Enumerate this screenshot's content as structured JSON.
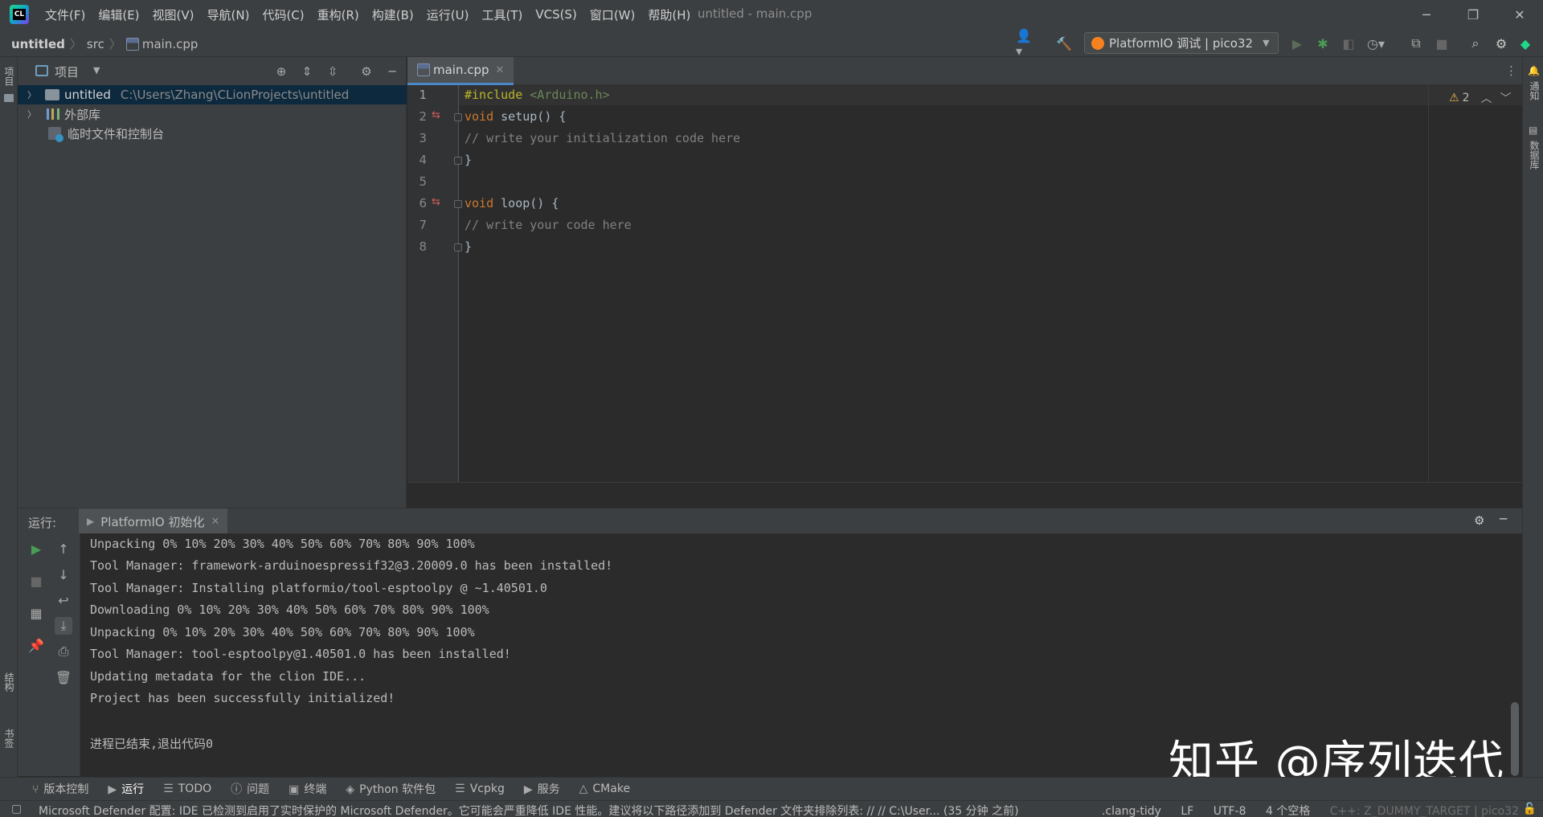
{
  "menu": [
    "文件(F)",
    "编辑(E)",
    "视图(V)",
    "导航(N)",
    "代码(C)",
    "重构(R)",
    "构建(B)",
    "运行(U)",
    "工具(T)",
    "VCS(S)",
    "窗口(W)",
    "帮助(H)"
  ],
  "window_title": "untitled - main.cpp",
  "window_controls": {
    "minimize": "─",
    "restore": "❐",
    "close": "✕"
  },
  "breadcrumb": {
    "project": "untitled",
    "folder": "src",
    "file": "main.cpp"
  },
  "run_config": {
    "label": "PlatformIO 调试 | pico32"
  },
  "left_strip": {
    "project_tab": "项目",
    "structure_tab": "结构",
    "bookmarks_tab": "书签"
  },
  "right_strip": {
    "notifications_tab": "通知",
    "database_tab": "数据库"
  },
  "project_panel": {
    "title": "项目",
    "tree": [
      {
        "label": "untitled",
        "path": "C:\\Users\\Zhang\\CLionProjects\\untitled"
      },
      {
        "label": "外部库"
      },
      {
        "label": "临时文件和控制台"
      }
    ]
  },
  "editor": {
    "tab_label": "main.cpp",
    "inspection_count": "2",
    "lines": [
      "1",
      "2",
      "3",
      "4",
      "5",
      "6",
      "7",
      "8"
    ],
    "code": {
      "l1_directive": "#include",
      "l1_header": " <Arduino.h>",
      "l2_kw": "void",
      "l2_rest": " setup() {",
      "l3_comment": "// write your initialization code here",
      "l4": "}",
      "l6_kw": "void",
      "l6_rest": " loop() {",
      "l7_comment": "// write your code here",
      "l8": "}"
    }
  },
  "run_panel": {
    "label": "运行:",
    "tab_label": "PlatformIO 初始化",
    "console": [
      "Unpacking 0% 10% 20% 30% 40% 50% 60% 70% 80% 90% 100%",
      "Tool Manager: framework-arduinoespressif32@3.20009.0 has been installed!",
      "Tool Manager: Installing platformio/tool-esptoolpy @ ~1.40501.0",
      "Downloading 0% 10% 20% 30% 40% 50% 60% 70% 80% 90% 100%",
      "Unpacking 0% 10% 20% 30% 40% 50% 60% 70% 80% 90% 100%",
      "Tool Manager: tool-esptoolpy@1.40501.0 has been installed!",
      "Updating metadata for the clion IDE...",
      "Project has been successfully initialized!",
      "",
      "进程已结束,退出代码0"
    ]
  },
  "watermark": "知乎 @序列迭代",
  "tool_windows": [
    "版本控制",
    "运行",
    "TODO",
    "问题",
    "终端",
    "Python 软件包",
    "Vcpkg",
    "服务",
    "CMake"
  ],
  "status": {
    "message": "Microsoft Defender 配置: IDE 已检测到启用了实时保护的 Microsoft Defender。它可能会严重降低 IDE 性能。建议将以下路径添加到 Defender 文件夹排除列表: // //  C:\\User... (35 分钟 之前)",
    "clang_tidy": ".clang-tidy",
    "line_sep": "LF",
    "encoding": "UTF-8",
    "indent": "4 个空格",
    "context": "C++: Z_DUMMY_TARGET | pico32"
  },
  "colors": {
    "accent": "#4a88c7",
    "selection": "#0d293e",
    "run_green": "#499c54",
    "keyword": "#cc7832",
    "string": "#6a8759",
    "comment": "#808080"
  }
}
